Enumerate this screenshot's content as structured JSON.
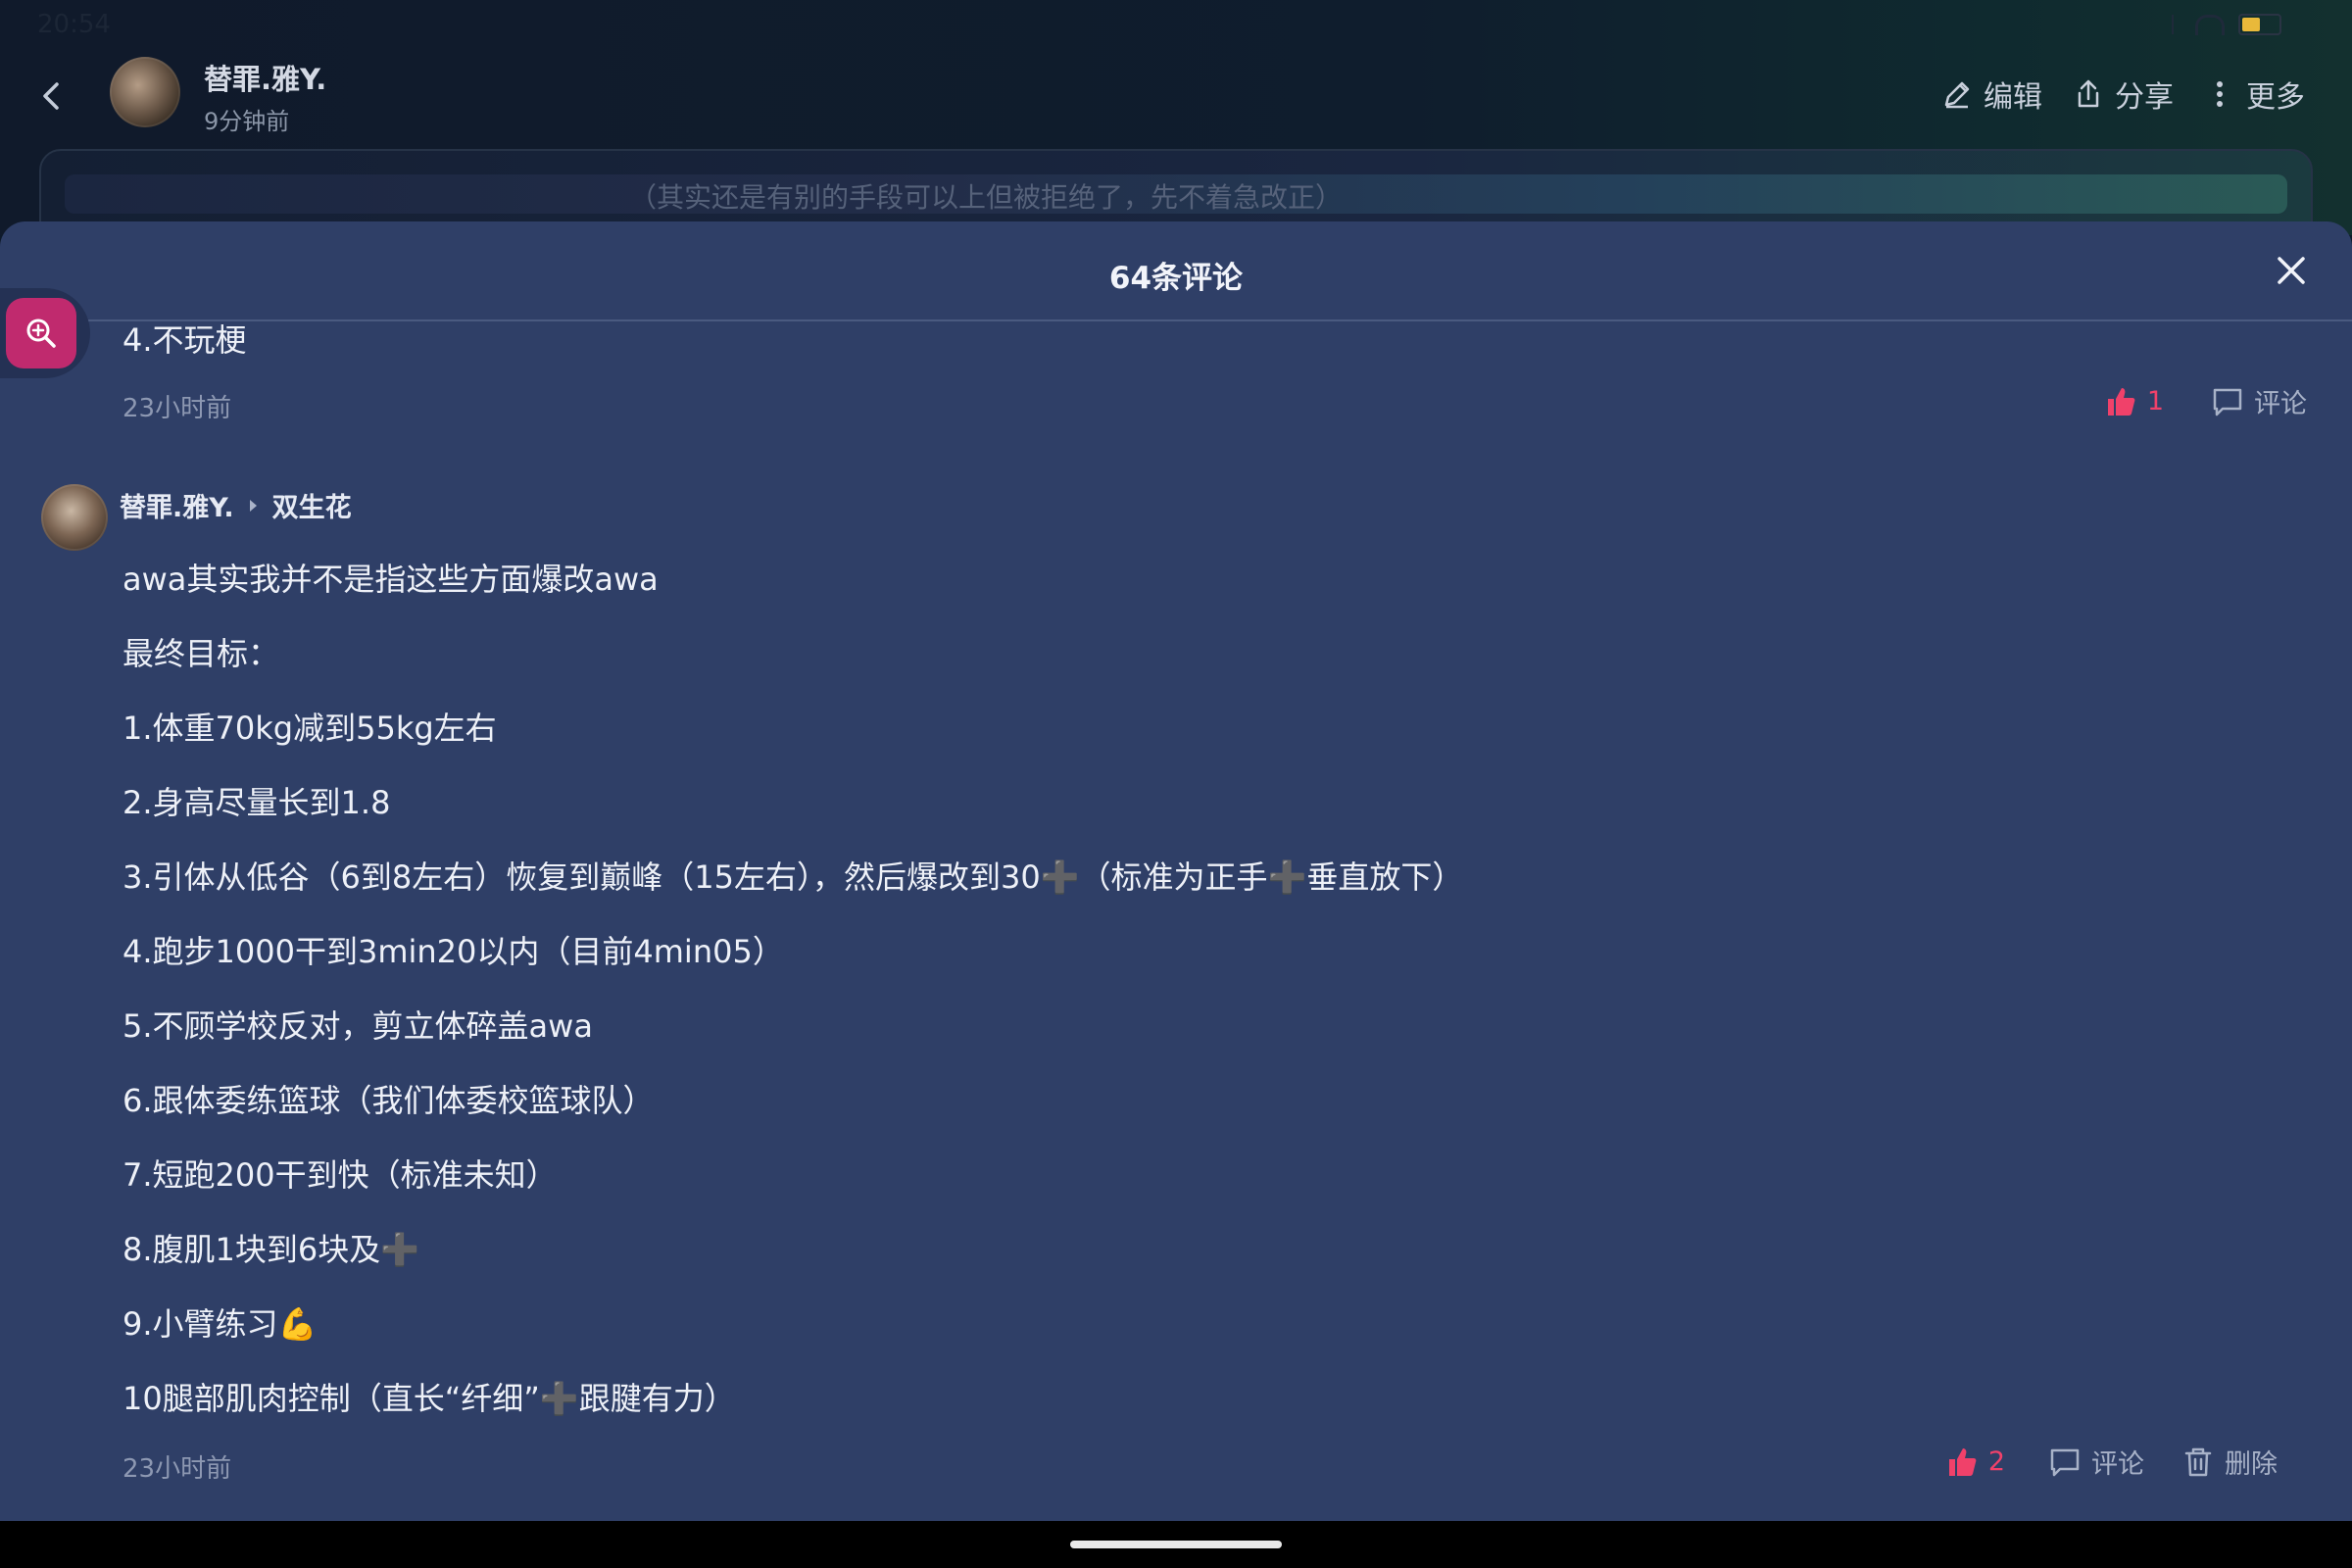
{
  "status_bar": {
    "time": "20:54",
    "battery": "5"
  },
  "header": {
    "author_name": "替罪.雅Y.",
    "post_time": "9分钟前",
    "actions": {
      "edit": "编辑",
      "share": "分享",
      "more": "更多"
    }
  },
  "post_peek": {
    "text": "（其实还是有别的手段可以上但被拒绝了，先不着急改正）"
  },
  "comments_sheet": {
    "title": "64条评论",
    "first_comment": {
      "last_line": "4.不玩梗",
      "time": "23小时前",
      "like_count": "1",
      "comment_label": "评论"
    },
    "reply": {
      "author": "替罪.雅Y.",
      "reply_to": "双生花",
      "lines": [
        "awa其实我并不是指这些方面爆改awa",
        "最终目标：",
        "1.体重70kg减到55kg左右",
        "2.身高尽量长到1.8",
        "3.引体从低谷（6到8左右）恢复到巅峰（15左右），然后爆改到30➕（标准为正手➕垂直放下）",
        "4.跑步1000干到3min20以内（目前4min05）",
        "5.不顾学校反对，剪立体碎盖awa",
        "6.跟体委练篮球（我们体委校篮球队）",
        "7.短跑200干到快（标准未知）",
        "8.腹肌1块到6块及➕",
        "9.小臂练习💪",
        "10腿部肌肉控制（直长“纤细”➕跟腱有力）"
      ],
      "time": "23小时前",
      "like_count": "2",
      "comment_label": "评论",
      "delete_label": "删除"
    }
  },
  "colors": {
    "sheet_bg": "#2f3f67",
    "like": "#f0416a",
    "zoom_button": "#c02a6e"
  }
}
